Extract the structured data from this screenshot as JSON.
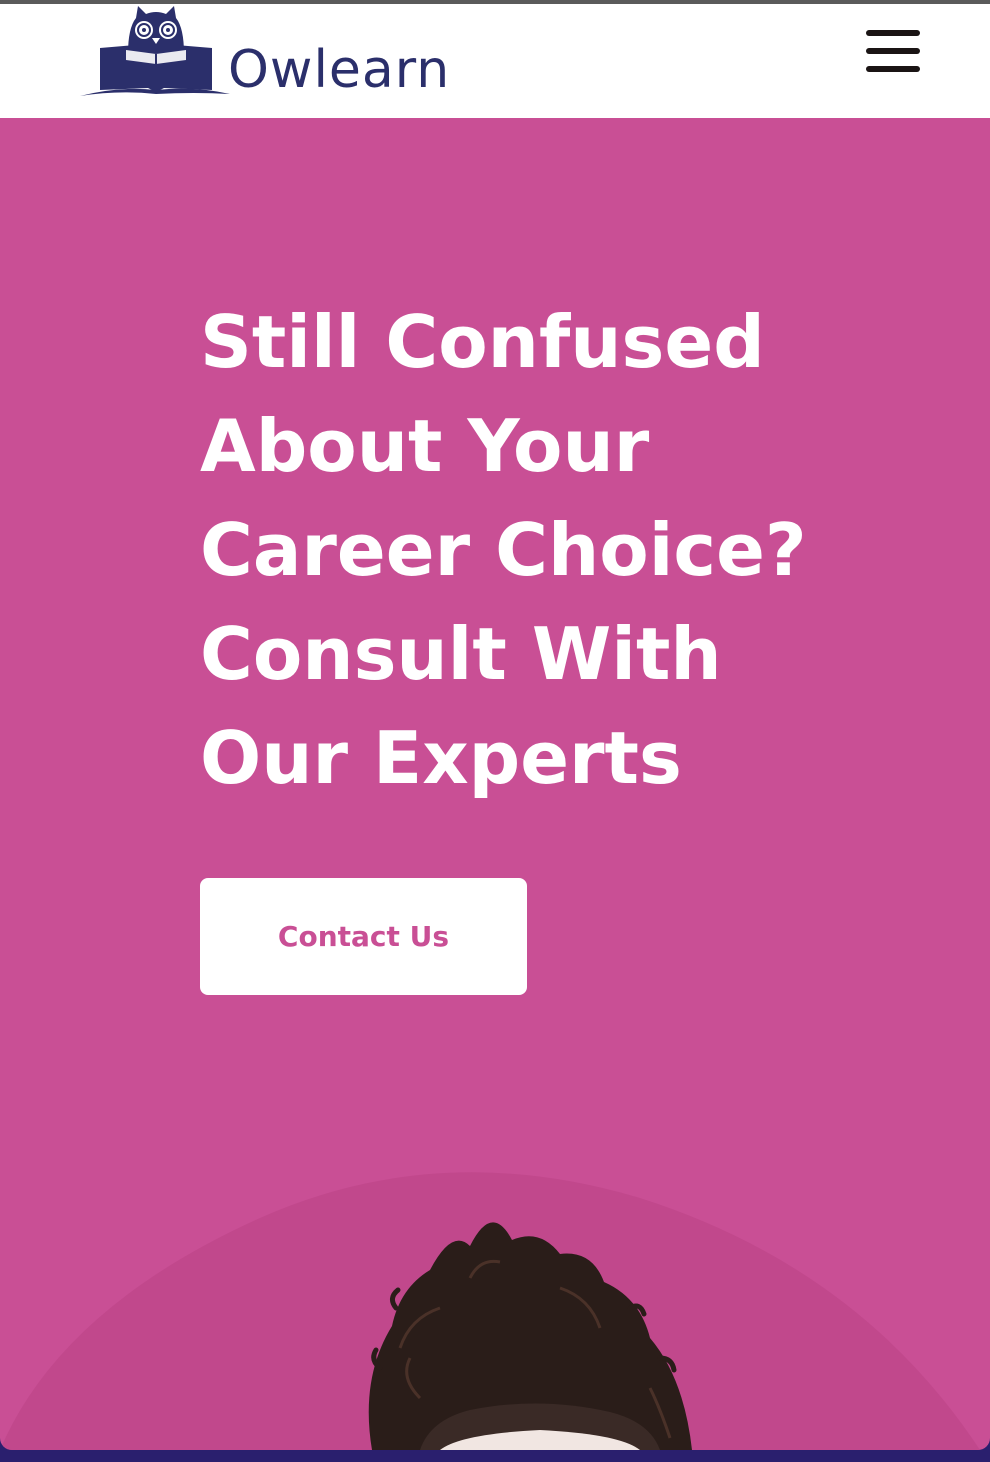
{
  "header": {
    "logo_text": "Owlearn"
  },
  "hero": {
    "title_lines": [
      "Still Confused",
      "About Your",
      "Career Choice?",
      "Consult With",
      "Our Experts"
    ],
    "cta_label": "Contact Us"
  },
  "icons": {
    "logo": "owl-reading-book-icon",
    "menu": "hamburger-menu-icon"
  },
  "colors": {
    "hero_background": "#c94f95",
    "brand_navy": "#2b2f6b",
    "header_background": "#ffffff",
    "cta_text": "#c94f95",
    "hamburger": "#1a1414"
  }
}
